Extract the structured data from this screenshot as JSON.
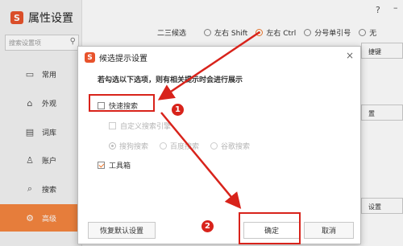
{
  "app": {
    "title": "属性设置",
    "logo_char": "S",
    "help": "?",
    "minimize": "–"
  },
  "sidebar": {
    "search_placeholder": "搜索设置项",
    "items": [
      {
        "icon": "▭",
        "label": "常用"
      },
      {
        "icon": "⌂",
        "label": "外观"
      },
      {
        "icon": "▤",
        "label": "词库"
      },
      {
        "icon": "♙",
        "label": "账户"
      },
      {
        "icon": "⌕",
        "label": "搜索"
      },
      {
        "icon": "⚙",
        "label": "高级"
      }
    ]
  },
  "settings": {
    "candidate_label": "二三候选",
    "options": [
      {
        "label": "左右 Shift",
        "selected": false
      },
      {
        "label": "左右 Ctrl",
        "selected": true
      },
      {
        "label": "分号单引号",
        "selected": false
      },
      {
        "label": "无",
        "selected": false
      }
    ],
    "right_buttons": [
      "捷键",
      "置",
      "设置"
    ]
  },
  "dialog": {
    "title": "候选提示设置",
    "message": "若勾选以下选项，则有相关提示时会进行展示",
    "close": "×",
    "quick_search": {
      "label": "快速搜索",
      "checked": false
    },
    "custom_engine": {
      "label": "自定义搜索引擎",
      "checked": false
    },
    "engines": [
      {
        "label": "搜狗搜索",
        "selected": true
      },
      {
        "label": "百度搜索",
        "selected": false
      },
      {
        "label": "谷歌搜索",
        "selected": false
      }
    ],
    "toolbox": {
      "label": "工具箱",
      "checked": true
    },
    "reset_label": "恢复默认设置",
    "ok_label": "确定",
    "cancel_label": "取消"
  },
  "annotations": {
    "badge_1": "1",
    "badge_2": "2",
    "color": "#d8231b"
  }
}
